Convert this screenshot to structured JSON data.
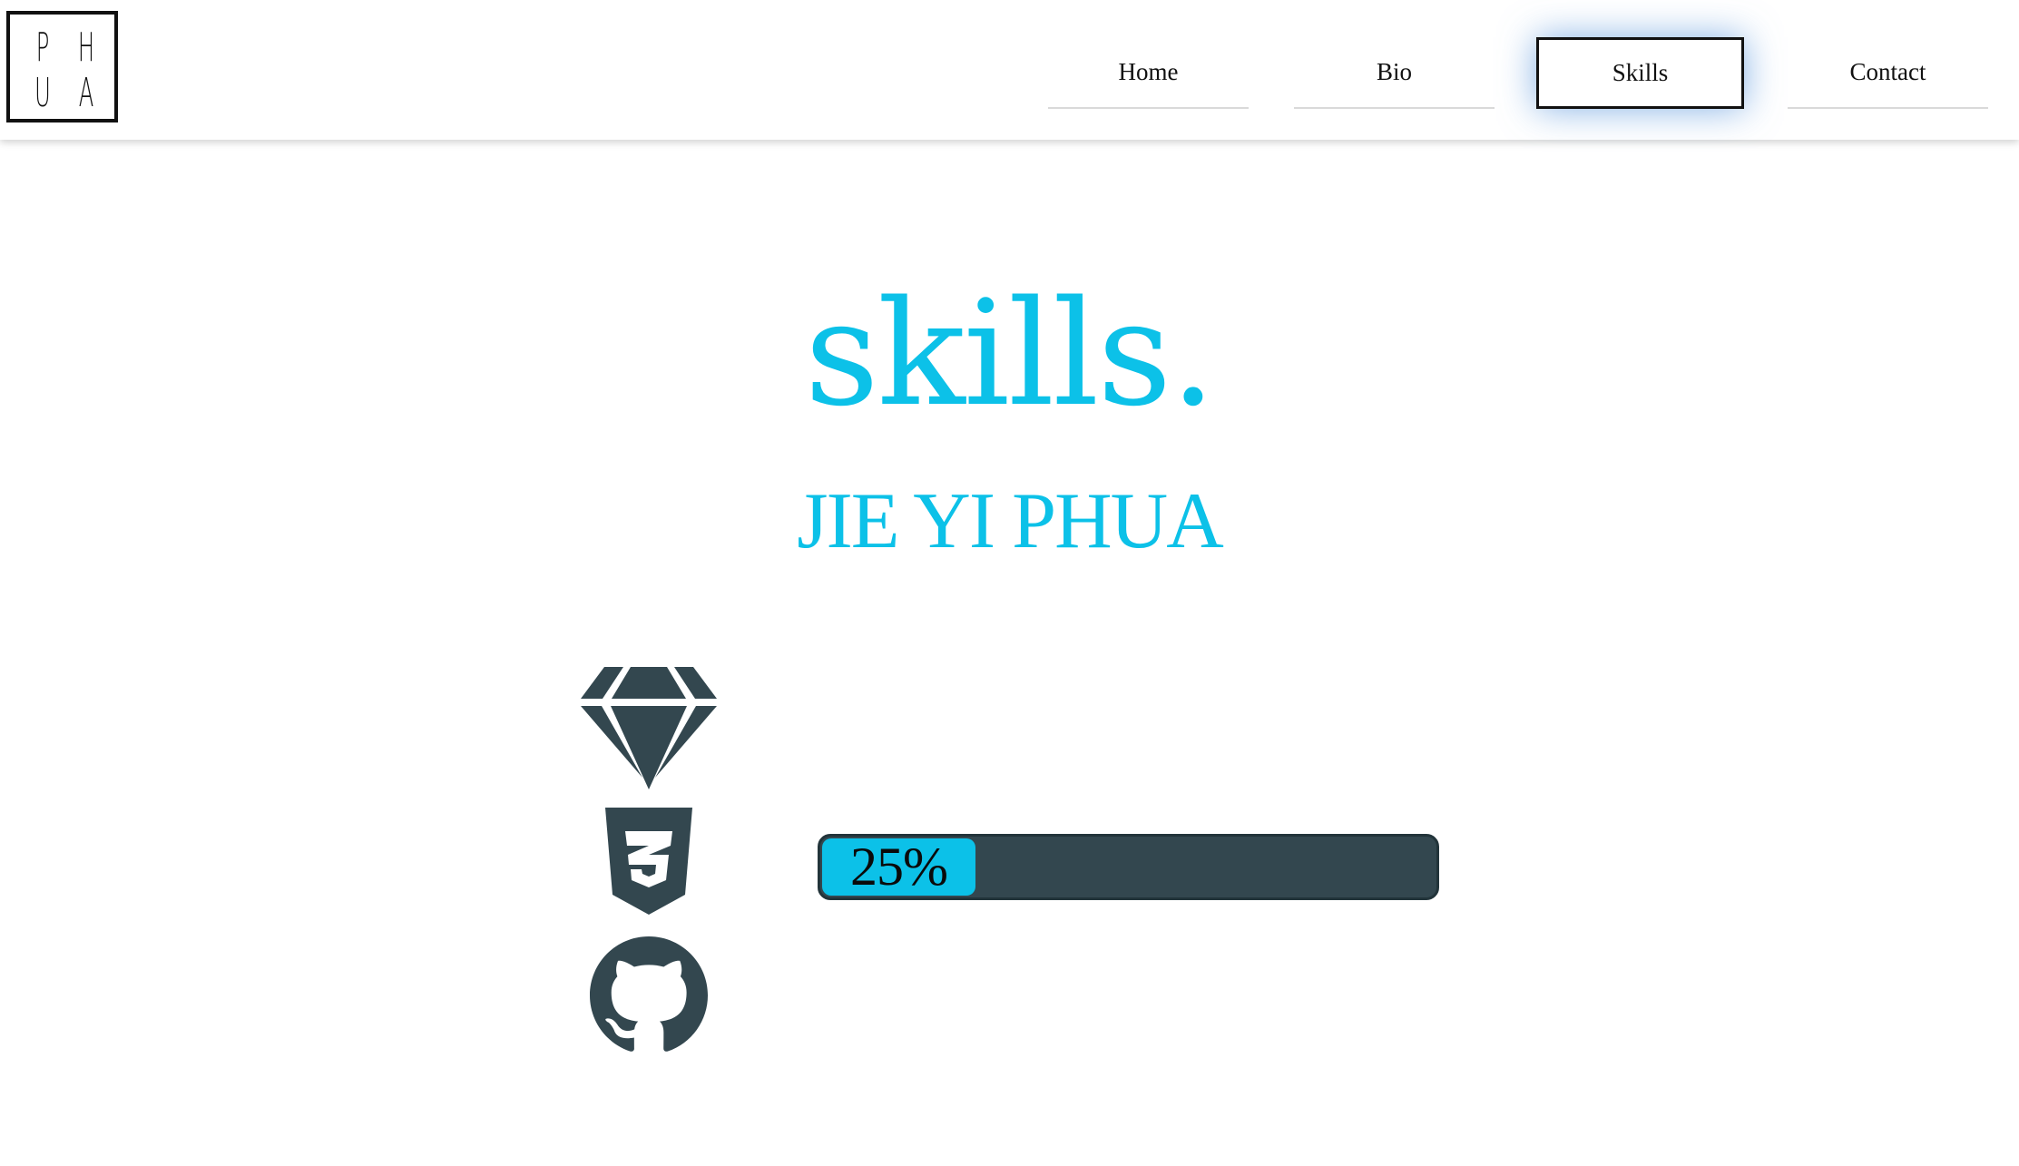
{
  "logo": {
    "letters": [
      "P",
      "H",
      "U",
      "A"
    ]
  },
  "nav": {
    "items": [
      {
        "label": "Home",
        "active": false
      },
      {
        "label": "Bio",
        "active": false
      },
      {
        "label": "Skills",
        "active": true
      },
      {
        "label": "Contact",
        "active": false
      }
    ]
  },
  "main": {
    "title": "skills.",
    "subtitle": "JIE YI PHUA",
    "skills": [
      {
        "icon": "sketch-diamond-icon"
      },
      {
        "icon": "css3-icon",
        "progress_label": "25%",
        "progress": 0.25
      },
      {
        "icon": "github-icon"
      }
    ]
  },
  "colors": {
    "accent": "#0cc1e8",
    "dark": "#33474f",
    "text": "#111111"
  }
}
